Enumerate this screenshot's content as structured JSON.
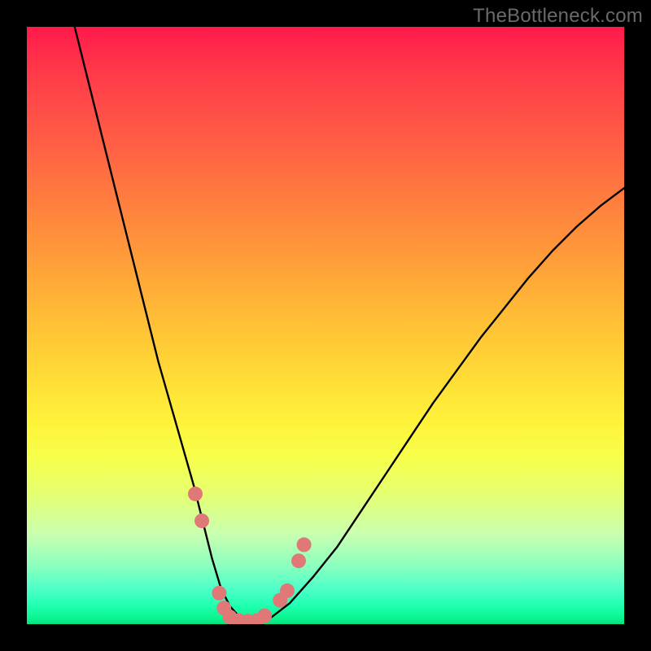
{
  "watermark": {
    "text": "TheBottleneck.com"
  },
  "gradient_colors": {
    "top": "#ff1a4a",
    "mid_orange": "#ff9a3a",
    "mid_yellow": "#fff23a",
    "bottom": "#07e07e"
  },
  "chart_data": {
    "type": "line",
    "title": "",
    "xlabel": "",
    "ylabel": "",
    "xlim": [
      0,
      100
    ],
    "ylim": [
      0,
      100
    ],
    "grid": false,
    "legend": false,
    "x": [
      8,
      10,
      12,
      14,
      16,
      18,
      20,
      22,
      24,
      26,
      28,
      29.5,
      31,
      32.5,
      34,
      35.5,
      37,
      39,
      41,
      44,
      48,
      52,
      56,
      60,
      64,
      68,
      72,
      76,
      80,
      84,
      88,
      92,
      96,
      100
    ],
    "values": [
      100,
      92,
      84,
      76,
      68,
      60,
      52,
      44,
      37,
      30,
      23,
      17,
      11,
      6,
      3,
      1.3,
      0.6,
      0.5,
      1.2,
      3.5,
      8,
      13,
      19,
      25,
      31,
      37,
      42.5,
      48,
      53,
      58,
      62.5,
      66.5,
      70,
      73
    ],
    "markers": {
      "color": "#e07878",
      "approx_radius_px": 9,
      "points": [
        {
          "x": 28.2,
          "y": 21.8
        },
        {
          "x": 29.3,
          "y": 17.3
        },
        {
          "x": 32.2,
          "y": 5.2
        },
        {
          "x": 33.0,
          "y": 2.7
        },
        {
          "x": 34.0,
          "y": 1.2
        },
        {
          "x": 35.5,
          "y": 0.6
        },
        {
          "x": 37.0,
          "y": 0.5
        },
        {
          "x": 38.5,
          "y": 0.6
        },
        {
          "x": 39.8,
          "y": 1.4
        },
        {
          "x": 42.4,
          "y": 4.0
        },
        {
          "x": 43.6,
          "y": 5.6
        },
        {
          "x": 45.5,
          "y": 10.6
        },
        {
          "x": 46.4,
          "y": 13.3
        }
      ]
    }
  }
}
